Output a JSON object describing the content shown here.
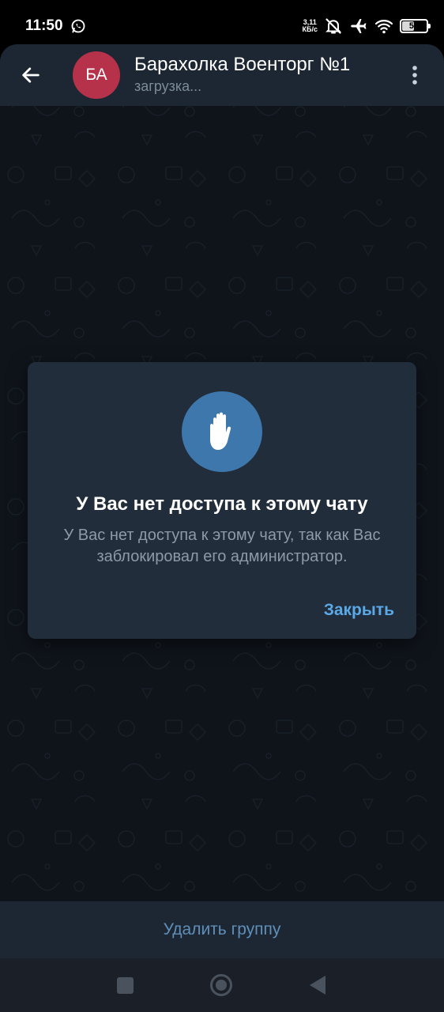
{
  "status_bar": {
    "time": "11:50",
    "speed_value": "3,11",
    "speed_unit": "КБ/с",
    "battery": "54",
    "battery_level": 0.54,
    "icons": [
      "whatsapp-icon",
      "dnd-bell-off-icon",
      "airplane-icon",
      "wifi-icon",
      "battery-icon"
    ]
  },
  "header": {
    "avatar_initials": "БА",
    "avatar_color": "#b6324a",
    "title": "Барахолка Военторг №1",
    "status": "загрузка..."
  },
  "dialog": {
    "icon": "raised-hand-icon",
    "title": "У Вас нет доступа к этому чату",
    "message": "У Вас нет доступа к этому чату, так как Вас заблокировал его администратор.",
    "close_label": "Закрыть"
  },
  "bottom_bar": {
    "action_label": "Удалить группу"
  },
  "colors": {
    "accent": "#5ba8e6",
    "dialog_bg": "#212d3b",
    "header_bg": "#1d2733",
    "icon_circle": "#3e77ab"
  }
}
